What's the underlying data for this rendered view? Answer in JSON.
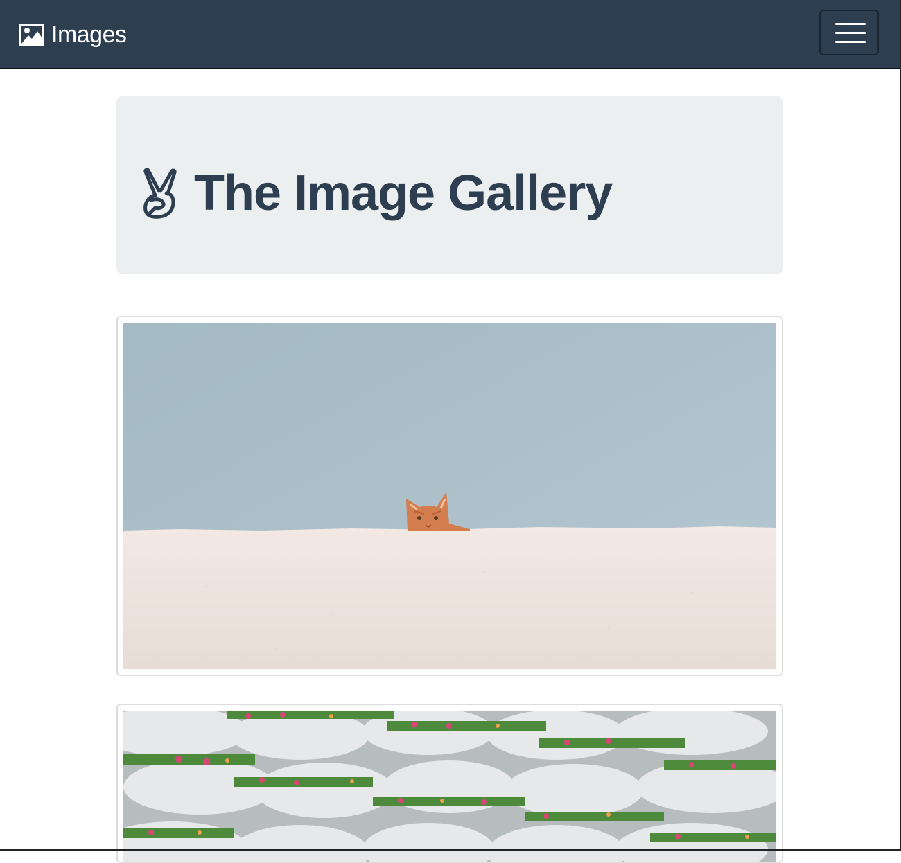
{
  "navbar": {
    "brand_label": "Images",
    "brand_icon": "image-icon",
    "toggler_icon": "hamburger-menu-icon",
    "background_color": "#2e3e51"
  },
  "jumbotron": {
    "title": "The Image Gallery",
    "title_icon": "victory-hand-icon",
    "background_color": "#ebeff0",
    "text_color": "#2e3e51"
  },
  "gallery": {
    "images": [
      {
        "name": "gallery-image-cat-on-wall"
      },
      {
        "name": "gallery-image-balconies-with-flowers"
      }
    ]
  }
}
